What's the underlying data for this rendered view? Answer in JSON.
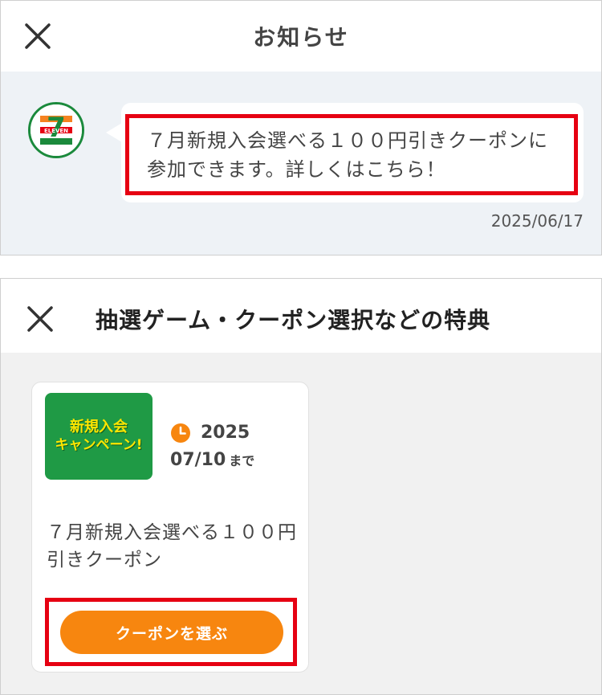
{
  "notice": {
    "title": "お知らせ",
    "message": "７月新規入会選べる１００円引きクーポンに参加できます。詳しくはこちら！",
    "date": "2025/06/17",
    "avatar": {
      "icon": "seven-eleven-logo",
      "number": "7",
      "text": "ELEVEN"
    }
  },
  "benefits": {
    "title": "抽選ゲーム・クーポン選択などの特典",
    "card": {
      "thumbnail_line1": "新規入会",
      "thumbnail_line2": "キャンペーン!",
      "deadline_year": "2025",
      "deadline_date": "07/10",
      "deadline_suffix": "まで",
      "title": "７月新規入会選べる１００円引きクーポン",
      "button_label": "クーポンを選ぶ"
    }
  },
  "icons": {
    "close": "close-icon",
    "clock": "clock-icon"
  },
  "colors": {
    "highlight": "#e60012",
    "button": "#f7860f",
    "brand_green": "#1b8a3c",
    "thumb_text": "#ffe600"
  }
}
